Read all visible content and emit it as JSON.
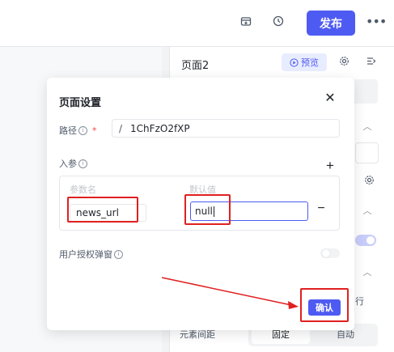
{
  "topbar": {
    "publish_label": "发布",
    "icons": [
      "save-icon",
      "history-icon",
      "more-icon"
    ]
  },
  "right_panel": {
    "page_title": "页面2",
    "preview_label": "预览",
    "element_spacing_label": "元素间距",
    "spacing_options": [
      "固定",
      "自动"
    ],
    "partial_label": "行"
  },
  "modal": {
    "title": "页面设置",
    "path_label": "路径",
    "required_mark": "*",
    "path_prefix": "/",
    "path_value": "1ChFzO2fXP",
    "params_label": "入参",
    "param_name_header": "参数名",
    "param_default_header": "默认值",
    "param_name_value": "news_url",
    "param_default_value": "null",
    "popup_auth_label": "用户授权弹窗",
    "popup_auth_enabled": false,
    "confirm_label": "确认"
  },
  "colors": {
    "accent": "#4e5bf2",
    "annotation": "#e02020"
  }
}
